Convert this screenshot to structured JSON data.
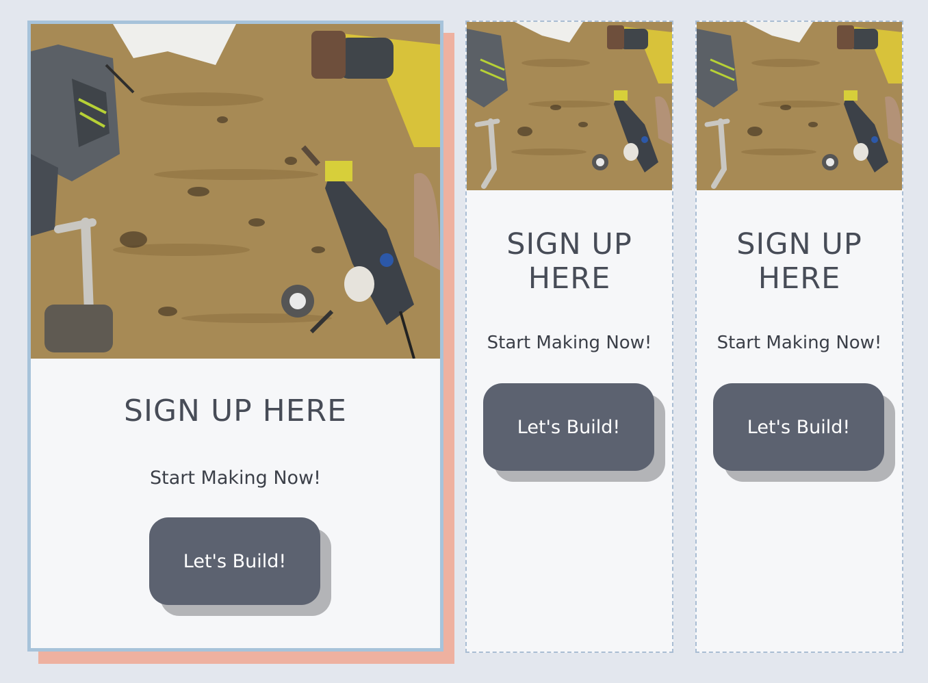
{
  "cards": [
    {
      "title": "SIGN UP HERE",
      "subtitle": "Start Making Now!",
      "button_label": "Let's Build!",
      "image_alt": "Workbench with power tools"
    },
    {
      "title": "SIGN UP HERE",
      "subtitle": "Start Making Now!",
      "button_label": "Let's Build!",
      "image_alt": "Workbench with power tools"
    },
    {
      "title": "SIGN UP HERE",
      "subtitle": "Start Making Now!",
      "button_label": "Let's Build!",
      "image_alt": "Workbench with power tools"
    }
  ],
  "colors": {
    "background": "#e3e7ee",
    "card_background": "#f6f7f9",
    "card_border_main": "#a7c3da",
    "card_offset_shadow": "#eeb1a0",
    "card_border_dashed": "#a9bdd3",
    "button": "#5c6270",
    "button_shadow": "#b3b4b7",
    "title_text": "#474c57"
  }
}
